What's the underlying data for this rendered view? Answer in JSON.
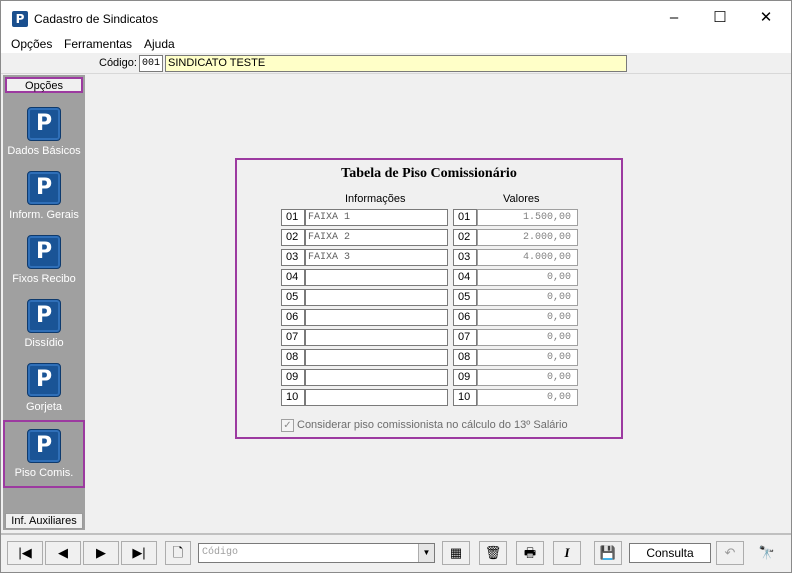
{
  "window": {
    "title": "Cadastro de Sindicatos",
    "app_icon": "P",
    "minimize": "–",
    "maximize": "☐",
    "close": "✕"
  },
  "menu": [
    "Opções",
    "Ferramentas",
    "Ajuda"
  ],
  "code_bar": {
    "label": "Código:",
    "code": "001",
    "name": "SINDICATO TESTE"
  },
  "sidebar": {
    "top_tab": "Opções",
    "bottom_tab": "Inf. Auxiliares",
    "items": [
      {
        "label": "Dados Básicos",
        "icon": "P"
      },
      {
        "label": "Inform. Gerais",
        "icon": "P"
      },
      {
        "label": "Fixos Recibo",
        "icon": "P"
      },
      {
        "label": "Dissídio",
        "icon": "P"
      },
      {
        "label": "Gorjeta",
        "icon": "P"
      },
      {
        "label": "Piso Comis.",
        "icon": "P"
      }
    ],
    "selected_index": 5
  },
  "panel": {
    "title": "Tabela de Piso Comissionário",
    "col_info": "Informações",
    "col_values": "Valores",
    "rows": [
      {
        "num": "01",
        "info": "FAIXA 1",
        "value": "1.500,00"
      },
      {
        "num": "02",
        "info": "FAIXA 2",
        "value": "2.000,00"
      },
      {
        "num": "03",
        "info": "FAIXA 3",
        "value": "4.000,00"
      },
      {
        "num": "04",
        "info": "",
        "value": "0,00"
      },
      {
        "num": "05",
        "info": "",
        "value": "0,00"
      },
      {
        "num": "06",
        "info": "",
        "value": "0,00"
      },
      {
        "num": "07",
        "info": "",
        "value": "0,00"
      },
      {
        "num": "08",
        "info": "",
        "value": "0,00"
      },
      {
        "num": "09",
        "info": "",
        "value": "0,00"
      },
      {
        "num": "10",
        "info": "",
        "value": "0,00"
      }
    ],
    "checkbox_label": "Considerar piso comissionista no cálculo do 13º Salário",
    "checkbox_mark": "✓",
    "checkbox_checked": true
  },
  "toolbar": {
    "first": "|◀",
    "prev": "◀",
    "next": "▶",
    "last": "▶|",
    "new_icon": "🗋",
    "combo_placeholder": "Código",
    "combo_arrow": "▼",
    "filter_icon": "▦",
    "delete_icon": "🗑",
    "print_icon": "🖶",
    "italic_icon": "I",
    "save_icon": "💾",
    "status": "Consulta",
    "undo_icon": "↶",
    "search_icon": "🔭"
  }
}
